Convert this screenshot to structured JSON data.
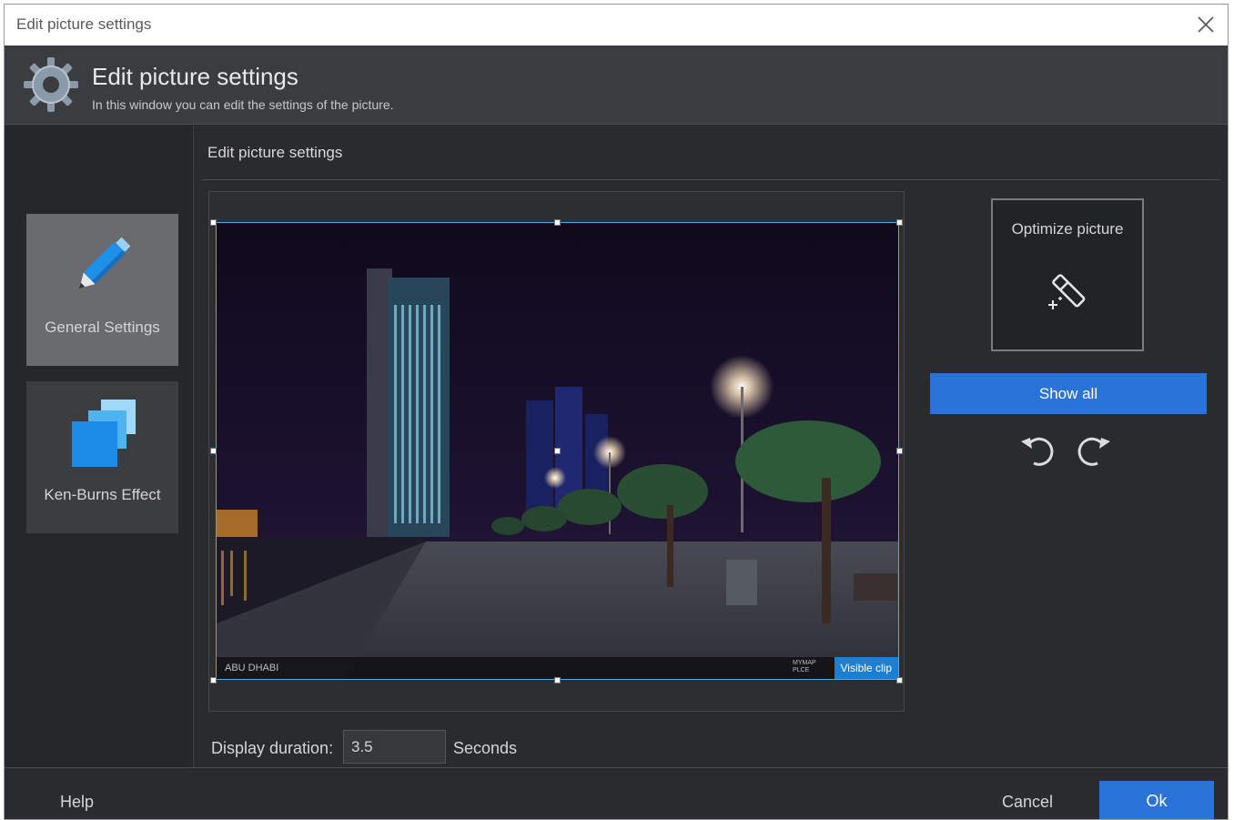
{
  "window": {
    "title": "Edit picture settings"
  },
  "header": {
    "title": "Edit picture settings",
    "subtitle": "In this window you can edit the settings of the picture.",
    "icon": "gear-icon"
  },
  "sidebar": {
    "items": [
      {
        "label": "General Settings",
        "icon": "pen-icon",
        "active": true
      },
      {
        "label": "Ken-Burns Effect",
        "icon": "ken-burns-squares-icon",
        "active": false
      }
    ]
  },
  "content": {
    "title": "Edit picture settings",
    "preview": {
      "caption_left": "ABU DHABI",
      "caption_right": "MYMAP PLCE",
      "visible_clip_label": "Visible clip"
    },
    "optimize": {
      "label": "Optimize picture",
      "icon": "magic-wand-icon"
    },
    "show_all_label": "Show all",
    "rotate_left_icon": "rotate-left-icon",
    "rotate_right_icon": "rotate-right-icon",
    "duration": {
      "label": "Display duration:",
      "value": "3.5",
      "unit": "Seconds"
    }
  },
  "footer": {
    "help_label": "Help",
    "cancel_label": "Cancel",
    "ok_label": "Ok"
  },
  "colors": {
    "accent": "#2a73d9",
    "clip_badge": "#1b7fd6",
    "background": "#2a2b2f",
    "header": "#3a3c40"
  }
}
